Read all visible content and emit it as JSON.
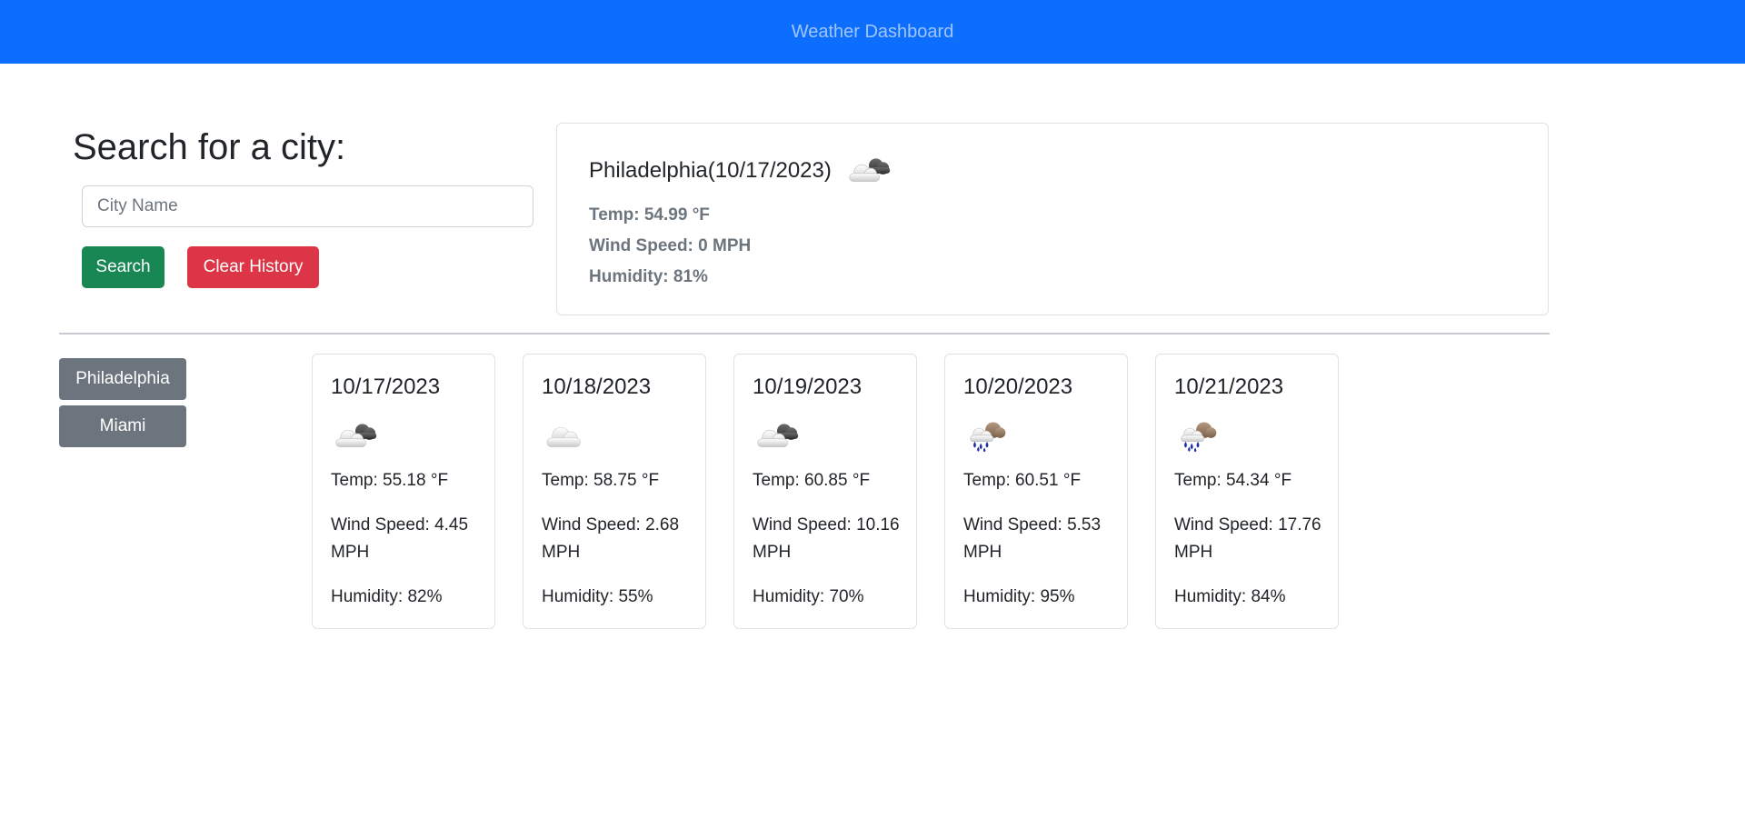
{
  "header": {
    "title": "Weather Dashboard"
  },
  "search": {
    "heading": "Search for a city:",
    "placeholder": "City Name",
    "value": "",
    "search_label": "Search",
    "clear_label": "Clear History"
  },
  "current": {
    "title": "Philadelphia(10/17/2023)",
    "icon": "partly-cloudy-icon",
    "temp": "Temp: 54.99 °F",
    "wind": "Wind Speed: 0 MPH",
    "humidity": "Humidity: 81%"
  },
  "history": [
    {
      "label": "Philadelphia"
    },
    {
      "label": "Miami"
    }
  ],
  "forecast": [
    {
      "date": "10/17/2023",
      "icon": "broken-clouds-icon",
      "temp": "Temp: 55.18 °F",
      "wind": "Wind Speed: 4.45 MPH",
      "humidity": "Humidity: 82%"
    },
    {
      "date": "10/18/2023",
      "icon": "cloud-icon",
      "temp": "Temp: 58.75 °F",
      "wind": "Wind Speed: 2.68 MPH",
      "humidity": "Humidity: 55%"
    },
    {
      "date": "10/19/2023",
      "icon": "broken-clouds-icon",
      "temp": "Temp: 60.85 °F",
      "wind": "Wind Speed: 10.16 MPH",
      "humidity": "Humidity: 70%"
    },
    {
      "date": "10/20/2023",
      "icon": "rain-icon",
      "temp": "Temp: 60.51 °F",
      "wind": "Wind Speed: 5.53 MPH",
      "humidity": "Humidity: 95%"
    },
    {
      "date": "10/21/2023",
      "icon": "rain-icon",
      "temp": "Temp: 54.34 °F",
      "wind": "Wind Speed: 17.76 MPH",
      "humidity": "Humidity: 84%"
    }
  ],
  "colors": {
    "navbar": "#0d6efd",
    "search_button": "#198754",
    "clear_button": "#dc3545",
    "history_button": "#6c757d"
  }
}
